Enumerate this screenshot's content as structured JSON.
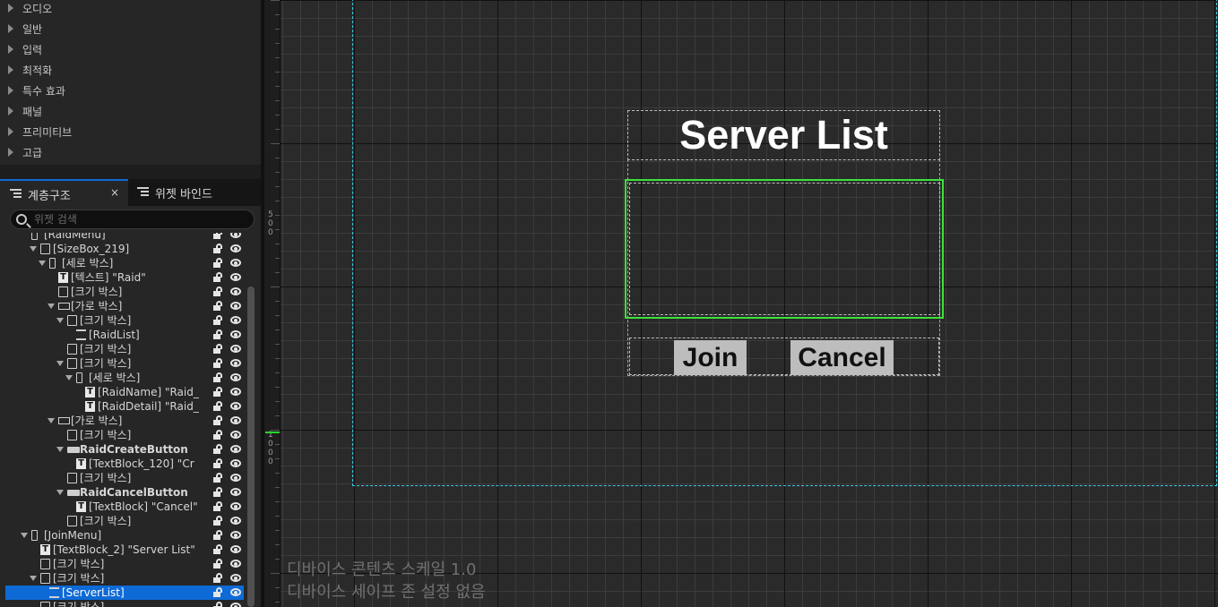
{
  "details_panel": {
    "categories": [
      "오디오",
      "일반",
      "입력",
      "최적화",
      "특수 효과",
      "패널",
      "프리미티브",
      "고급"
    ]
  },
  "tabs": {
    "hierarchy": "계층구조",
    "bindings": "위젯 바인드",
    "close": "×"
  },
  "search": {
    "placeholder": "위젯 검색"
  },
  "hierarchy_rows": [
    {
      "label": "[RaidMenu]",
      "icon": "vertical-box-icon"
    },
    {
      "label": "[SizeBox_219]",
      "icon": "size-box-icon"
    },
    {
      "label": "[세로 박스]",
      "icon": "vertical-box-icon"
    },
    {
      "label": "[텍스트] \"Raid\"",
      "icon": "text-icon"
    },
    {
      "label": "[크기 박스]",
      "icon": "size-box-icon"
    },
    {
      "label": "[가로 박스]",
      "icon": "horizontal-box-icon"
    },
    {
      "label": "[크기 박스]",
      "icon": "size-box-icon"
    },
    {
      "label": "[RaidList]",
      "icon": "list-view-icon"
    },
    {
      "label": "[크기 박스]",
      "icon": "size-box-icon"
    },
    {
      "label": "[크기 박스]",
      "icon": "size-box-icon"
    },
    {
      "label": "[세로 박스]",
      "icon": "vertical-box-icon"
    },
    {
      "label": "[RaidName] \"Raid_",
      "icon": "text-icon"
    },
    {
      "label": "[RaidDetail] \"Raid_",
      "icon": "text-icon"
    },
    {
      "label": "[가로 박스]",
      "icon": "horizontal-box-icon"
    },
    {
      "label": "[크기 박스]",
      "icon": "size-box-icon"
    },
    {
      "label": "RaidCreateButton",
      "icon": "button-icon"
    },
    {
      "label": "[TextBlock_120] \"Cr",
      "icon": "text-icon"
    },
    {
      "label": "[크기 박스]",
      "icon": "size-box-icon"
    },
    {
      "label": "RaidCancelButton",
      "icon": "button-icon"
    },
    {
      "label": "[TextBlock] \"Cancel\"",
      "icon": "text-icon"
    },
    {
      "label": "[크기 박스]",
      "icon": "size-box-icon"
    },
    {
      "label": "[JoinMenu]",
      "icon": "vertical-box-icon"
    },
    {
      "label": "[TextBlock_2] \"Server List\"",
      "icon": "text-icon"
    },
    {
      "label": "[크기 박스]",
      "icon": "size-box-icon"
    },
    {
      "label": "[크기 박스]",
      "icon": "size-box-icon"
    },
    {
      "label": "[ServerList]",
      "icon": "list-view-icon",
      "selected": true
    },
    {
      "label": "[크기 박스]",
      "icon": "size-box-icon"
    }
  ],
  "ruler": {
    "labels": [
      "5\n0\n0",
      "1\n0\n0\n0"
    ]
  },
  "canvas": {
    "title": "Server List",
    "join": "Join",
    "cancel": "Cancel"
  },
  "dpi_info": {
    "scale": "디바이스 콘텐츠 스케일 1.0",
    "safe_zone": "디바이스 세이프 존 설정 없음"
  },
  "colors": {
    "selection": "#0e6ad6",
    "selected_widget_outline": "#3de03d",
    "screen_outline": "#3ec8e6"
  }
}
